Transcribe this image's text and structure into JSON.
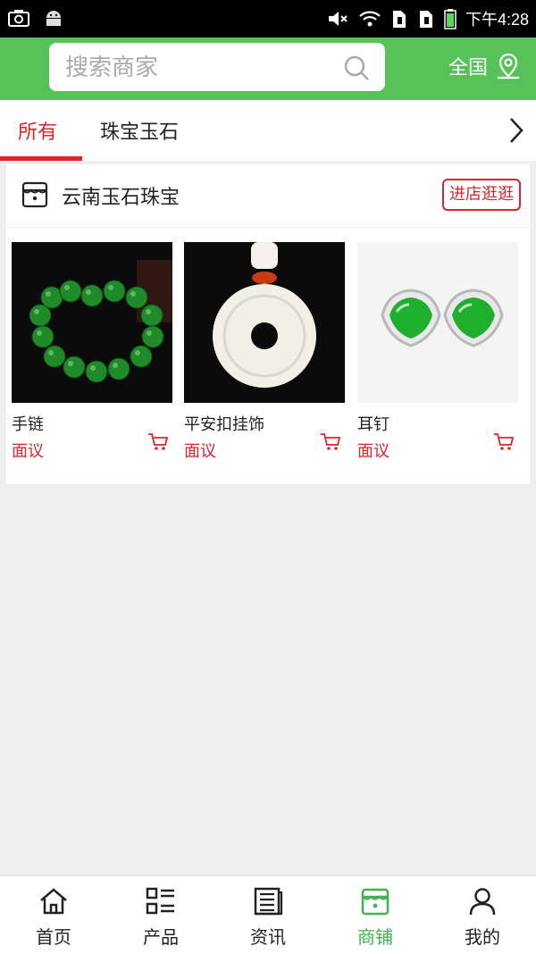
{
  "status_bar": {
    "time": "下午4:28"
  },
  "search": {
    "placeholder": "搜索商家"
  },
  "region": {
    "label": "全国"
  },
  "tabs": [
    {
      "label": "所有",
      "active": true
    },
    {
      "label": "珠宝玉石",
      "active": false
    }
  ],
  "shop": {
    "name": "云南玉石珠宝",
    "enter_label": "进店逛逛",
    "products": [
      {
        "name": "手链",
        "price": "面议"
      },
      {
        "name": "平安扣挂饰",
        "price": "面议"
      },
      {
        "name": "耳钉",
        "price": "面议"
      }
    ]
  },
  "bottom_nav": [
    {
      "label": "首页",
      "icon": "home-icon"
    },
    {
      "label": "产品",
      "icon": "grid-list-icon"
    },
    {
      "label": "资讯",
      "icon": "news-icon"
    },
    {
      "label": "商铺",
      "icon": "store-icon",
      "active": true
    },
    {
      "label": "我的",
      "icon": "user-icon"
    }
  ],
  "colors": {
    "green": "#56c257",
    "red": "#d9252b",
    "nav_active": "#3fb34f"
  }
}
